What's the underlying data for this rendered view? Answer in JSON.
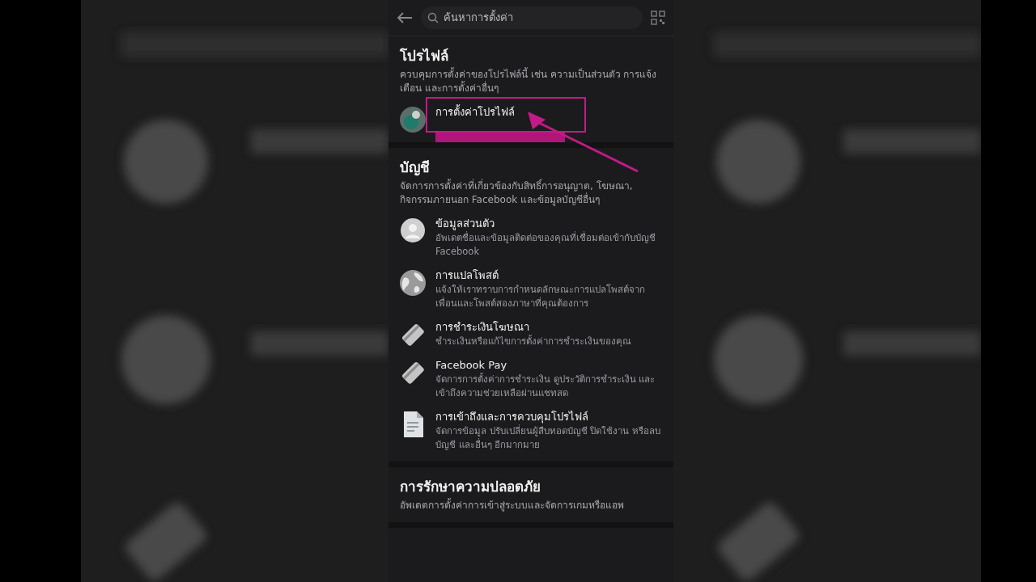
{
  "search": {
    "placeholder": "ค้นหาการตั้งค่า"
  },
  "sections": [
    {
      "title": "โปรไฟล์",
      "description": "ควบคุมการตั้งค่าของโปรไฟล์นี้ เช่น ความเป็นส่วนตัว การแจ้งเตือน และการตั้งค่าอื่นๆ",
      "items": [
        {
          "title": "การตั้งค่าโปรไฟล์",
          "highlighted": true
        }
      ]
    },
    {
      "title": "บัญชี",
      "description": "จัดการการตั้งค่าที่เกี่ยวข้องกับสิทธิ์การอนุญาต, โฆษณา, กิจกรรมภายนอก Facebook และข้อมูลบัญชีอื่นๆ",
      "items": [
        {
          "kind": "person",
          "title": "ข้อมูลส่วนตัว",
          "subtitle": "อัพเดตชื่อและข้อมูลติดต่อของคุณที่เชื่อมต่อเข้ากับบัญชี Facebook"
        },
        {
          "kind": "globe",
          "title": "การแปลโพสต์",
          "subtitle": "แจ้งให้เราทราบการกำหนดลักษณะการแปลโพสต์จากเพื่อนและโพสต์สองภาษาที่คุณต้องการ"
        },
        {
          "kind": "card",
          "title": "การชำระเงินโฆษณา",
          "subtitle": "ชำระเงินหรือแก้ไขการตั้งค่าการชำระเงินของคุณ"
        },
        {
          "kind": "card",
          "title": "Facebook Pay",
          "subtitle": "จัดการการตั้งค่าการชำระเงิน ดูประวัติการชำระเงิน และเข้าถึงความช่วยเหลือผ่านแชทสด"
        },
        {
          "kind": "document",
          "title": "การเข้าถึงและการควบคุมโปรไฟล์",
          "subtitle": "จัดการข้อมูล ปรับเปลี่ยนผู้สืบทอดบัญชี ปิดใช้งาน หรือลบบัญชี และอื่นๆ อีกมากมาย"
        }
      ]
    },
    {
      "title": "การรักษาความปลอดภัย",
      "description": "อัพเดตการตั้งค่าการเข้าสู่ระบบและจัดการเกมหรือแอพ"
    }
  ]
}
